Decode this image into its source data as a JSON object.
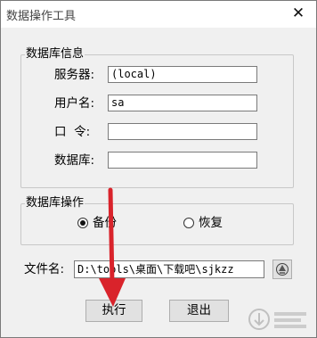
{
  "window": {
    "title": "数据操作工具",
    "close_glyph": "✕"
  },
  "db_group": {
    "legend": "数据库信息",
    "server_label": "服务器:",
    "server_value": "(local)",
    "user_label": "用户名:",
    "user_value": "sa",
    "password_label": "口  令:",
    "password_value": "",
    "database_label": "数据库:",
    "database_value": ""
  },
  "op_group": {
    "legend": "数据库操作",
    "options": [
      {
        "label": "备份",
        "selected": true
      },
      {
        "label": "恢复",
        "selected": false
      }
    ]
  },
  "file": {
    "label": "文件名:",
    "value": "D:\\tools\\桌面\\下载吧\\sjkzz",
    "browse_icon": "folder-browse-icon"
  },
  "buttons": {
    "execute": "执行",
    "exit": "退出"
  },
  "annotation": {
    "arrow_color": "#d9232b"
  },
  "watermark": {
    "icon": "download-watermark-icon"
  }
}
